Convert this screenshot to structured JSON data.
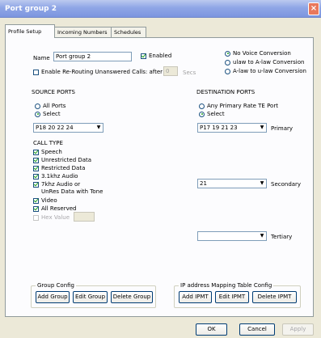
{
  "window": {
    "title": "Port group 2"
  },
  "tabs": [
    {
      "label": "Profile Setup"
    },
    {
      "label": "Incoming Numbers"
    },
    {
      "label": "Schedules"
    }
  ],
  "profile": {
    "name_label": "Name",
    "name_value": "Port group 2",
    "enabled_label": "Enabled",
    "enabled_checked": true,
    "rerouting_label": "Enable Re-Routing Unanswered Calls: after",
    "rerouting_value": "0",
    "rerouting_unit": "Secs"
  },
  "conversion": {
    "options": [
      {
        "label": "No Voice Conversion",
        "selected": true
      },
      {
        "label": "ulaw to A-law Conversion",
        "selected": false
      },
      {
        "label": "A-law to u-law Conversion",
        "selected": false
      }
    ]
  },
  "source": {
    "heading": "SOURCE PORTS",
    "all_ports_label": "All Ports",
    "select_label": "Select",
    "selected_option": "select",
    "ports_value": "P18 20 22 24"
  },
  "destination": {
    "heading": "DESTINATION PORTS",
    "any_label": "Any Primary Rate TE Port",
    "select_label": "Select",
    "primary_value": "P17 19 21 23",
    "primary_label": "Primary",
    "secondary_value": "21",
    "secondary_label": "Secondary",
    "tertiary_value": "",
    "tertiary_label": "Tertiary"
  },
  "call_type": {
    "heading": "CALL TYPE",
    "items": [
      {
        "label": "Speech",
        "checked": true
      },
      {
        "label": "Unrestricted Data",
        "checked": true
      },
      {
        "label": "Restricted Data",
        "checked": true
      },
      {
        "label": "3.1khz Audio",
        "checked": true
      },
      {
        "label": "7khz Audio or",
        "label2": "UnRes Data with Tone",
        "checked": true
      },
      {
        "label": "Video",
        "checked": true
      },
      {
        "label": "All Reserved",
        "checked": true
      }
    ],
    "hex_label": "Hex Value",
    "hex_value": ""
  },
  "group_config": {
    "legend": "Group Config",
    "add": "Add Group",
    "edit": "Edit Group",
    "delete": "Delete Group"
  },
  "ip_mapping": {
    "legend": "IP address Mapping Table Config",
    "add": "Add IPMT",
    "edit": "Edit IPMT",
    "delete": "Delete IPMT"
  },
  "footer": {
    "ok": "OK",
    "cancel": "Cancel",
    "apply": "Apply"
  }
}
